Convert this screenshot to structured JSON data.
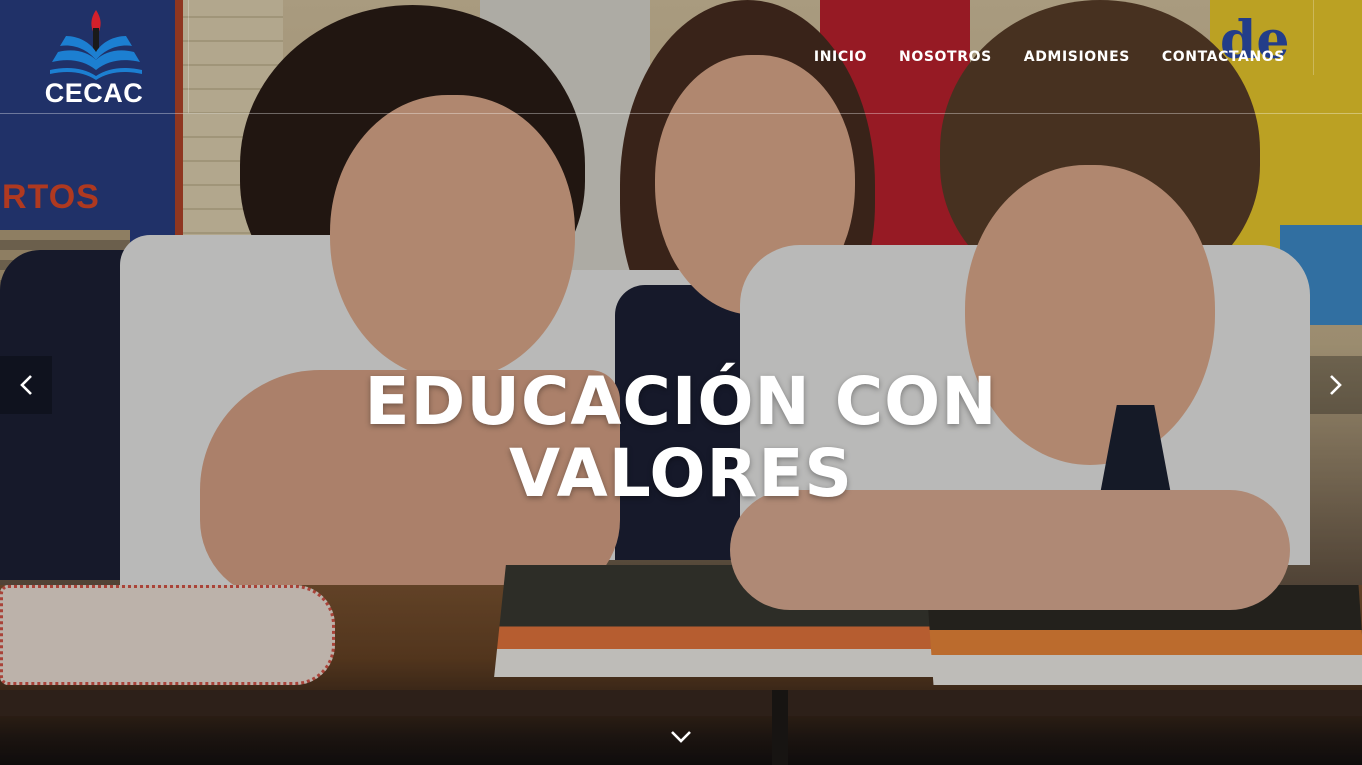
{
  "brand": {
    "name": "CECAC",
    "colors": {
      "logo_blue": "#1c7fd1",
      "flame_red": "#d4202b",
      "white": "#ffffff"
    }
  },
  "nav": {
    "items": [
      {
        "label": "INICIO"
      },
      {
        "label": "NOSOTROS"
      },
      {
        "label": "ADMISIONES"
      },
      {
        "label": "CONTACTANOS"
      }
    ]
  },
  "hero": {
    "headline_line1": "EDUCACIÓN CON",
    "headline_line2": "VALORES",
    "prev_icon": "chevron-left-icon",
    "next_icon": "chevron-right-icon",
    "scroll_icon": "chevron-down-icon"
  }
}
